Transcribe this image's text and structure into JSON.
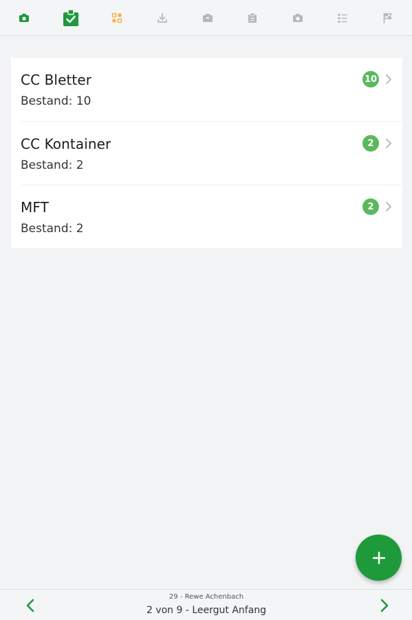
{
  "colors": {
    "accent": "#1e9a3b",
    "badge": "#5bb85d",
    "inactive_icon": "#b5b8bc",
    "orange_icon": "#f3b14f"
  },
  "toolbar": {
    "icons": [
      {
        "name": "camera-bag-icon",
        "state": "active"
      },
      {
        "name": "clipboard-check-icon",
        "state": "selected"
      },
      {
        "name": "grid-icon",
        "state": "highlight"
      },
      {
        "name": "download-icon",
        "state": "disabled"
      },
      {
        "name": "box-icon",
        "state": "disabled"
      },
      {
        "name": "clipboard-icon",
        "state": "disabled"
      },
      {
        "name": "camera-icon",
        "state": "disabled"
      },
      {
        "name": "checklist-icon",
        "state": "disabled"
      },
      {
        "name": "flag-icon",
        "state": "disabled"
      }
    ]
  },
  "items": [
    {
      "title": "CC Bletter",
      "subtitle": "Bestand: 10",
      "count": "10"
    },
    {
      "title": "CC Kontainer",
      "subtitle": "Bestand: 2",
      "count": "2"
    },
    {
      "title": "MFT",
      "subtitle": "Bestand: 2",
      "count": "2"
    }
  ],
  "fab": {
    "icon": "plus-icon"
  },
  "footer": {
    "store": "29 - Rewe Achenbach",
    "step": "2 von 9 - Leergut Anfang"
  }
}
